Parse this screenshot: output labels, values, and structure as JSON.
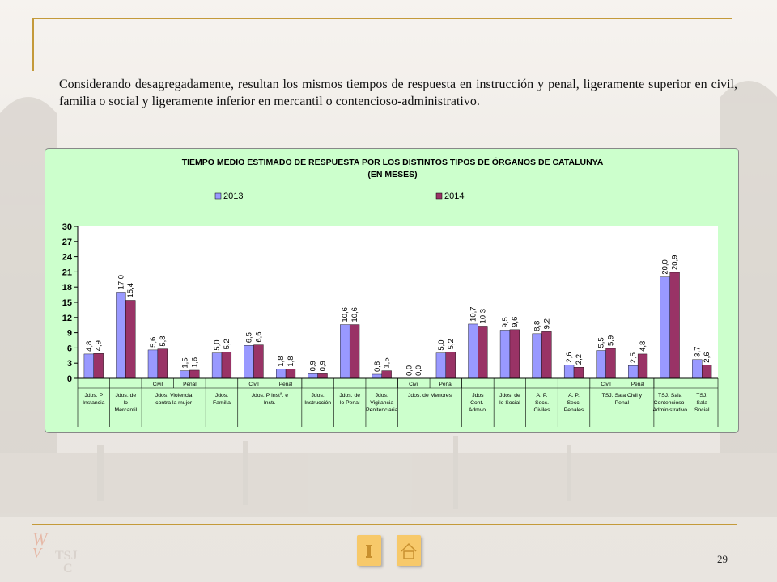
{
  "page": {
    "intro_text": "Considerando desagregadamente, resultan los mismos tiempos de respuesta en instrucción y penal,  ligeramente superior en civil,  familia o social y ligeramente inferior en mercantil o contencioso-administrativo.",
    "page_number": "29",
    "logo_letters": "TSJC",
    "nav_icons": [
      "info-icon",
      "home-icon"
    ]
  },
  "chart_data": {
    "type": "bar",
    "title": "TIEMPO MEDIO ESTIMADO DE RESPUESTA POR LOS DISTINTOS TIPOS DE ÓRGANOS DE CATALUNYA",
    "subtitle": "(EN MESES)",
    "ylim": [
      0,
      30
    ],
    "yticks": [
      "0",
      "3",
      "6",
      "9",
      "12",
      "15",
      "18",
      "21",
      "24",
      "27",
      "30"
    ],
    "grid": false,
    "legend_position": "top",
    "colors": {
      "2013": "#9999ff",
      "2014": "#993366",
      "plot_bg": "#ffffff",
      "box_bg": "#ccffcc"
    },
    "series": [
      {
        "name": "2013",
        "values": [
          4.8,
          17.0,
          5.6,
          1.5,
          5.0,
          6.5,
          1.8,
          0.9,
          10.6,
          0.8,
          0.0,
          5.0,
          10.7,
          9.5,
          8.8,
          2.6,
          5.5,
          2.5,
          20.0,
          3.7
        ],
        "labels": [
          "4,8",
          "17,0",
          "5,6",
          "1,5",
          "5,0",
          "6,5",
          "1,8",
          "0,9",
          "10,6",
          "0,8",
          "0,0",
          "5,0",
          "10,7",
          "9,5",
          "8,8",
          "2,6",
          "5,5",
          "2,5",
          "20,0",
          "3,7"
        ]
      },
      {
        "name": "2014",
        "values": [
          4.9,
          15.4,
          5.8,
          1.6,
          5.2,
          6.6,
          1.8,
          0.9,
          10.6,
          1.5,
          0.0,
          5.2,
          10.3,
          9.6,
          9.2,
          2.2,
          5.9,
          4.8,
          20.9,
          2.6
        ],
        "labels": [
          "4,9",
          "15,4",
          "5,8",
          "1,6",
          "5,2",
          "6,6",
          "1,8",
          "0,9",
          "10,6",
          "1,5",
          "0,0",
          "5,2",
          "10,3",
          "9,6",
          "9,2",
          "2,2",
          "5,9",
          "4,8",
          "20,9",
          "2,6"
        ]
      }
    ],
    "sub_categories": [
      "",
      "",
      "Civil",
      "Penal",
      "",
      "Civil",
      "Penal",
      "",
      "",
      "",
      "Civil",
      "Penal",
      "",
      "",
      "",
      "",
      "Civil",
      "Penal",
      "",
      ""
    ],
    "groups": [
      {
        "span": 1,
        "lines": [
          "Jdos. P",
          "Instancia"
        ]
      },
      {
        "span": 1,
        "lines": [
          "Jdos. de",
          "lo",
          "Mercantil"
        ]
      },
      {
        "span": 2,
        "lines": [
          "Jdos. Violencia",
          "contra la mujer"
        ]
      },
      {
        "span": 1,
        "lines": [
          "Jdos.",
          "Familia"
        ]
      },
      {
        "span": 2,
        "lines": [
          "Jdos.  P Instª. e",
          "Instr."
        ]
      },
      {
        "span": 1,
        "lines": [
          "Jdos.",
          "Instrucción"
        ]
      },
      {
        "span": 1,
        "lines": [
          "Jdos. de",
          "lo Penal"
        ]
      },
      {
        "span": 1,
        "lines": [
          "Jdos.",
          "Vigilancia",
          "Penitenciaria"
        ]
      },
      {
        "span": 2,
        "lines": [
          "Jdos. de Menores"
        ]
      },
      {
        "span": 1,
        "lines": [
          "Jdos",
          "Cont.-",
          "Admvo."
        ]
      },
      {
        "span": 1,
        "lines": [
          "Jdos. de",
          "lo Social"
        ]
      },
      {
        "span": 1,
        "lines": [
          "A. P.",
          "Secc.",
          "Civiles"
        ]
      },
      {
        "span": 1,
        "lines": [
          "A. P.",
          "Secc.",
          "Penales"
        ]
      },
      {
        "span": 2,
        "lines": [
          "TSJ. Sala Civil y",
          "Penal"
        ]
      },
      {
        "span": 1,
        "lines": [
          "TSJ. Sala",
          "Contencioso-",
          "Administrativo"
        ]
      },
      {
        "span": 1,
        "lines": [
          "TSJ.",
          "Sala",
          "Social"
        ]
      }
    ]
  }
}
